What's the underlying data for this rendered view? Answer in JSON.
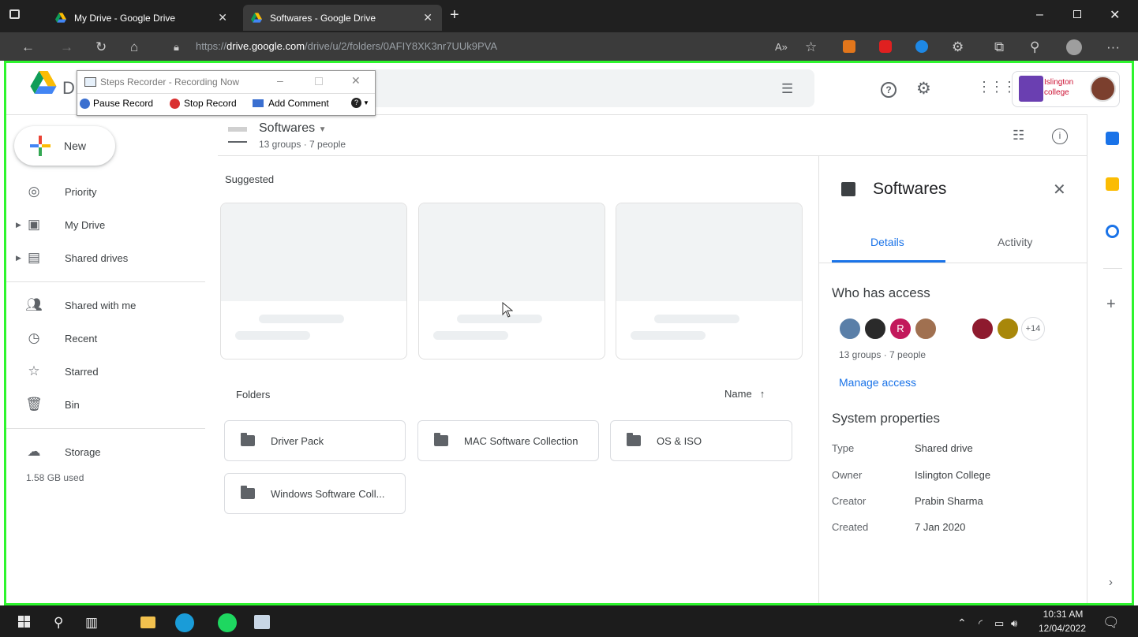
{
  "browser": {
    "tabs": [
      {
        "title": "My Drive - Google Drive",
        "icon": "google-drive-icon"
      },
      {
        "title": "Softwares - Google Drive",
        "icon": "google-drive-icon"
      }
    ],
    "url_prefix": "https://",
    "url_domain": "drive.google.com",
    "url_path": "/drive/u/2/folders/0AFIY8XK3nr7UUk9PVA"
  },
  "steps_recorder": {
    "title": "Steps Recorder - Recording Now",
    "pause": "Pause Record",
    "stop": "Stop Record",
    "comment": "Add Comment"
  },
  "drive": {
    "logo_text": "Dı",
    "new_label": "New",
    "nav": [
      {
        "label": "Priority",
        "icon": "priority-icon"
      },
      {
        "label": "My Drive",
        "icon": "my-drive-icon"
      },
      {
        "label": "Shared drives",
        "icon": "shared-drives-icon"
      },
      {
        "label": "Shared with me",
        "icon": "shared-with-me-icon"
      },
      {
        "label": "Recent",
        "icon": "clock-icon"
      },
      {
        "label": "Starred",
        "icon": "star-icon"
      },
      {
        "label": "Bin",
        "icon": "bin-icon"
      },
      {
        "label": "Storage",
        "icon": "cloud-icon"
      }
    ],
    "storage_used": "1.58 GB used",
    "account_name": "Islington college"
  },
  "main": {
    "folder_title": "Softwares",
    "folder_sub": "13 groups · 7 people",
    "suggested": "Suggested",
    "folders_label": "Folders",
    "sort_label": "Name",
    "folders": [
      "Driver Pack",
      "MAC Software Collection",
      "OS & ISO",
      "Windows Software Coll..."
    ]
  },
  "details": {
    "title": "Softwares",
    "tab_details": "Details",
    "tab_activity": "Activity",
    "who_has_access": "Who has access",
    "more_count": "+14",
    "access_summary": "13 groups · 7 people",
    "manage_access": "Manage access",
    "system_properties": "System properties",
    "props": [
      {
        "k": "Type",
        "v": "Shared drive"
      },
      {
        "k": "Owner",
        "v": "Islington College"
      },
      {
        "k": "Creator",
        "v": "Prabin Sharma"
      },
      {
        "k": "Created",
        "v": "7 Jan 2020"
      }
    ],
    "avatar_letter": "R"
  },
  "taskbar": {
    "time": "10:31 AM",
    "date": "12/04/2022"
  },
  "colors": {
    "frame": "#2ef52e",
    "link": "#1a73e8"
  }
}
